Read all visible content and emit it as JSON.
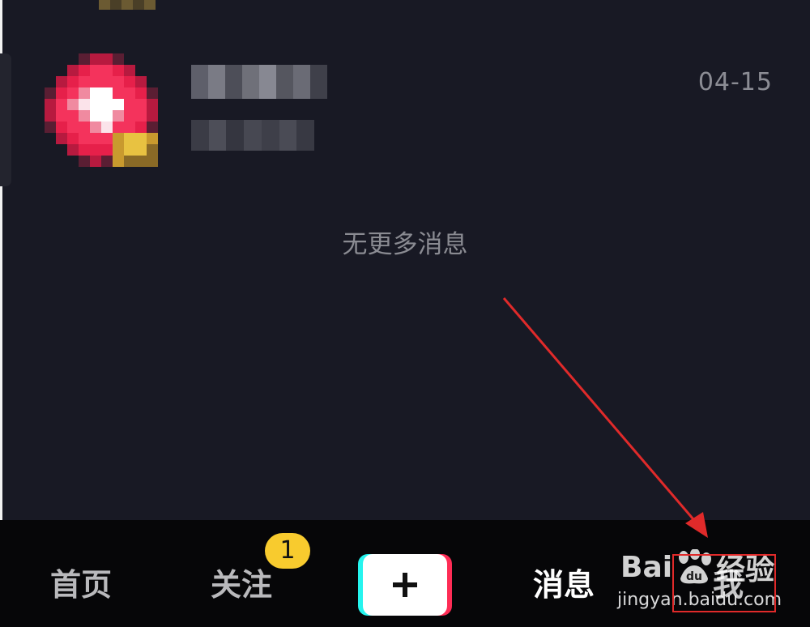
{
  "messages": {
    "items": [
      {
        "name": "",
        "preview": "",
        "time": "04-15"
      }
    ],
    "empty_hint": "无更多消息"
  },
  "tab_bar": {
    "home_label": "首页",
    "follow_label": "关注",
    "follow_badge": "1",
    "add_icon": "plus-icon",
    "messages_label": "消息",
    "me_label": "我",
    "active_tab": "消息",
    "badge_color": "#f8cb2e"
  },
  "watermark": {
    "logo_text_left": "Bai",
    "logo_text_right": "经验",
    "url": "jingyan.baidu.com"
  },
  "colors": {
    "background": "#181924",
    "tab_bar": "#060608",
    "annotation_red": "#e02a2a",
    "brand_cyan": "#25f4ee",
    "brand_pink": "#fe2c55"
  }
}
